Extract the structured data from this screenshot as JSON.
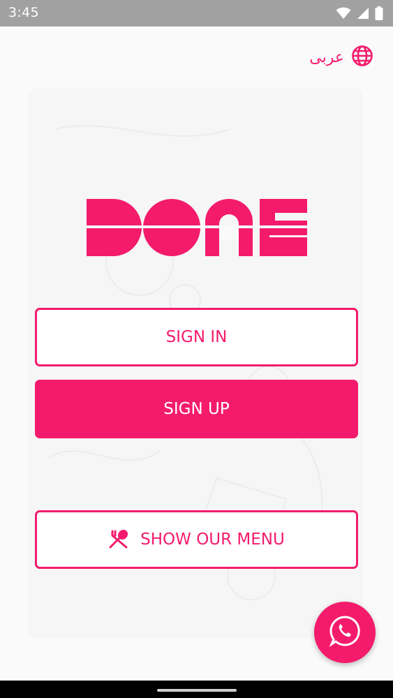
{
  "status_bar": {
    "time": "3:45",
    "icons": [
      "wifi-icon",
      "signal-icon",
      "battery-icon"
    ]
  },
  "language": {
    "label": "عربى",
    "icon": "globe-icon"
  },
  "logo": {
    "text": "DONE"
  },
  "buttons": {
    "sign_in": "SIGN IN",
    "sign_up": "SIGN UP",
    "show_menu": "SHOW OUR MENU",
    "show_menu_icon": "fork-spoon-icon"
  },
  "fab": {
    "icon": "whatsapp-icon"
  },
  "colors": {
    "brand": "#f41b6c",
    "status_bar": "#a1a1a1",
    "background": "#fafafa"
  }
}
